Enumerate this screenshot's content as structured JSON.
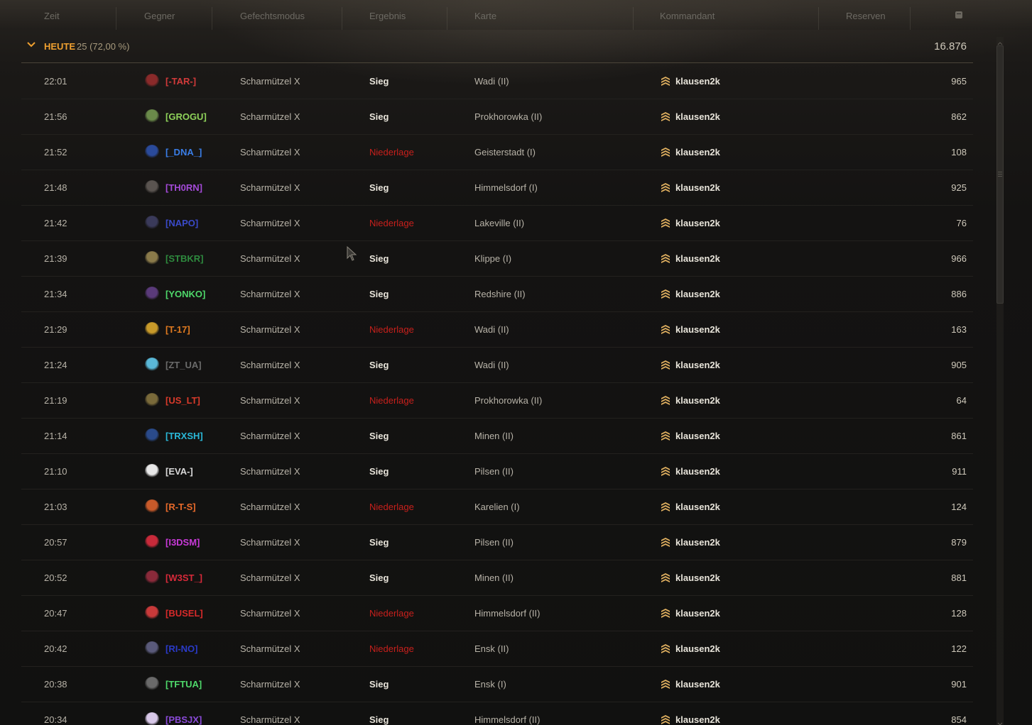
{
  "header": {
    "columns": [
      "Zeit",
      "Gegner",
      "Gefechtsmodus",
      "Ergebnis",
      "Karte",
      "Kommandant",
      "Reserven"
    ],
    "reserves_icon": "box-icon"
  },
  "group": {
    "label": "HEUTE",
    "count": "25 (72,00 %)",
    "total": "16.876"
  },
  "colors": {
    "win": "#e8e4da",
    "loss": "#c8201c",
    "group_label": "#f0a030"
  },
  "rows": [
    {
      "time": "22:01",
      "clan": "[-TAR-]",
      "clan_color": "#d23a3a",
      "emblem": "#8a2a2a",
      "mode": "Scharmützel X",
      "result": "Sieg",
      "outcome": "win",
      "map": "Wadi (II)",
      "commander": "klausen2k",
      "points": "965"
    },
    {
      "time": "21:56",
      "clan": "[GROGU]",
      "clan_color": "#8fd35a",
      "emblem": "#6a8a4a",
      "mode": "Scharmützel X",
      "result": "Sieg",
      "outcome": "win",
      "map": "Prokhorowka (II)",
      "commander": "klausen2k",
      "points": "862"
    },
    {
      "time": "21:52",
      "clan": "[_DNA_]",
      "clan_color": "#3a7ee8",
      "emblem": "#2a4a9a",
      "mode": "Scharmützel X",
      "result": "Niederlage",
      "outcome": "loss",
      "map": "Geisterstadt (I)",
      "commander": "klausen2k",
      "points": "108"
    },
    {
      "time": "21:48",
      "clan": "[TH0RN]",
      "clan_color": "#a44ad8",
      "emblem": "#5a5450",
      "mode": "Scharmützel X",
      "result": "Sieg",
      "outcome": "win",
      "map": "Himmelsdorf (I)",
      "commander": "klausen2k",
      "points": "925"
    },
    {
      "time": "21:42",
      "clan": "[NAPO]",
      "clan_color": "#3a4ac8",
      "emblem": "#3a3a5a",
      "mode": "Scharmützel X",
      "result": "Niederlage",
      "outcome": "loss",
      "map": "Lakeville (II)",
      "commander": "klausen2k",
      "points": "76"
    },
    {
      "time": "21:39",
      "clan": "[STBKR]",
      "clan_color": "#2e8a3e",
      "emblem": "#8a7a4a",
      "mode": "Scharmützel X",
      "result": "Sieg",
      "outcome": "win",
      "map": "Klippe (I)",
      "commander": "klausen2k",
      "points": "966"
    },
    {
      "time": "21:34",
      "clan": "[YONKO]",
      "clan_color": "#4ed86a",
      "emblem": "#5a3a7a",
      "mode": "Scharmützel X",
      "result": "Sieg",
      "outcome": "win",
      "map": "Redshire (II)",
      "commander": "klausen2k",
      "points": "886"
    },
    {
      "time": "21:29",
      "clan": "[T-17]",
      "clan_color": "#e07a20",
      "emblem": "#c89a2a",
      "mode": "Scharmützel X",
      "result": "Niederlage",
      "outcome": "loss",
      "map": "Wadi (II)",
      "commander": "klausen2k",
      "points": "163"
    },
    {
      "time": "21:24",
      "clan": "[ZT_UA]",
      "clan_color": "#6a6a6a",
      "emblem": "#5ab8d8",
      "mode": "Scharmützel X",
      "result": "Sieg",
      "outcome": "win",
      "map": "Wadi (II)",
      "commander": "klausen2k",
      "points": "905"
    },
    {
      "time": "21:19",
      "clan": "[US_LT]",
      "clan_color": "#d83a2a",
      "emblem": "#7a6a3a",
      "mode": "Scharmützel X",
      "result": "Niederlage",
      "outcome": "loss",
      "map": "Prokhorowka (II)",
      "commander": "klausen2k",
      "points": "64"
    },
    {
      "time": "21:14",
      "clan": "[TRXSH]",
      "clan_color": "#2ab8d8",
      "emblem": "#2a4a8a",
      "mode": "Scharmützel X",
      "result": "Sieg",
      "outcome": "win",
      "map": "Minen (II)",
      "commander": "klausen2k",
      "points": "861"
    },
    {
      "time": "21:10",
      "clan": "[EVA-]",
      "clan_color": "#d8d8d8",
      "emblem": "#e8e8e8",
      "mode": "Scharmützel X",
      "result": "Sieg",
      "outcome": "win",
      "map": "Pilsen (II)",
      "commander": "klausen2k",
      "points": "911"
    },
    {
      "time": "21:03",
      "clan": "[R-T-S]",
      "clan_color": "#e86a2a",
      "emblem": "#c85a2a",
      "mode": "Scharmützel X",
      "result": "Niederlage",
      "outcome": "loss",
      "map": "Karelien (I)",
      "commander": "klausen2k",
      "points": "124"
    },
    {
      "time": "20:57",
      "clan": "[I3DSM]",
      "clan_color": "#c83ad8",
      "emblem": "#c82a3a",
      "mode": "Scharmützel X",
      "result": "Sieg",
      "outcome": "win",
      "map": "Pilsen (II)",
      "commander": "klausen2k",
      "points": "879"
    },
    {
      "time": "20:52",
      "clan": "[W3ST_]",
      "clan_color": "#d82a3a",
      "emblem": "#8a2a3a",
      "mode": "Scharmützel X",
      "result": "Sieg",
      "outcome": "win",
      "map": "Minen (II)",
      "commander": "klausen2k",
      "points": "881"
    },
    {
      "time": "20:47",
      "clan": "[BUSEL]",
      "clan_color": "#d82a2a",
      "emblem": "#c83a3a",
      "mode": "Scharmützel X",
      "result": "Niederlage",
      "outcome": "loss",
      "map": "Himmelsdorf (II)",
      "commander": "klausen2k",
      "points": "128"
    },
    {
      "time": "20:42",
      "clan": "[RI-NO]",
      "clan_color": "#2a3ac8",
      "emblem": "#5a5a7a",
      "mode": "Scharmützel X",
      "result": "Niederlage",
      "outcome": "loss",
      "map": "Ensk (II)",
      "commander": "klausen2k",
      "points": "122"
    },
    {
      "time": "20:38",
      "clan": "[TFTUA]",
      "clan_color": "#4ed86a",
      "emblem": "#6a6a6a",
      "mode": "Scharmützel X",
      "result": "Sieg",
      "outcome": "win",
      "map": "Ensk (I)",
      "commander": "klausen2k",
      "points": "901"
    },
    {
      "time": "20:34",
      "clan": "[PBSJX]",
      "clan_color": "#8a4ad8",
      "emblem": "#d8c8e8",
      "mode": "Scharmützel X",
      "result": "Sieg",
      "outcome": "win",
      "map": "Himmelsdorf (II)",
      "commander": "klausen2k",
      "points": "854"
    }
  ]
}
